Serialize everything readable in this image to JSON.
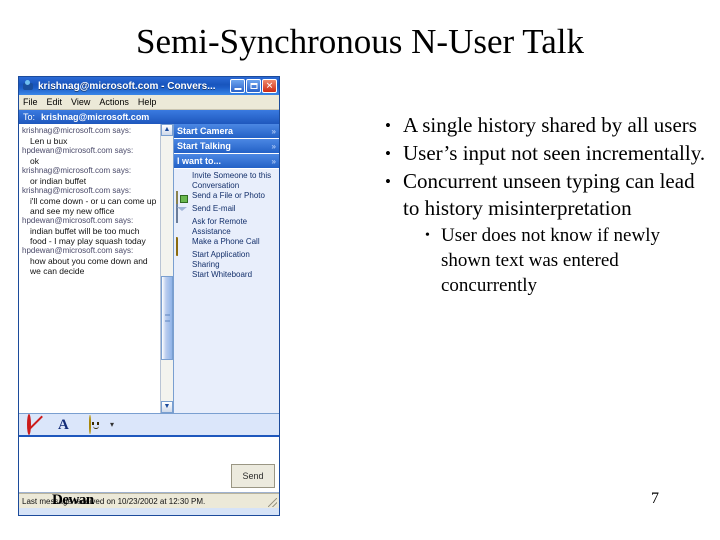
{
  "slide": {
    "title": "Semi-Synchronous  N-User Talk",
    "page_number": "7",
    "footer_author": "Dewan"
  },
  "bullets": [
    {
      "level": 1,
      "marker": "•",
      "text": "A single history shared by all users"
    },
    {
      "level": 1,
      "marker": "•",
      "text": "User’s input not seen incrementally."
    },
    {
      "level": 1,
      "marker": "•",
      "text": "Concurrent unseen typing can lead to history misinterpretation"
    },
    {
      "level": 2,
      "marker": "•",
      "text": "User does not know if newly shown text was entered concurrently"
    }
  ],
  "messenger": {
    "titlebar": {
      "title": "krishnag@microsoft.com - Convers...",
      "minimize_label": "Minimize",
      "maximize_label": "Maximize",
      "close_label": "Close"
    },
    "menubar": [
      "File",
      "Edit",
      "View",
      "Actions",
      "Help"
    ],
    "to_bar": {
      "label": "To:",
      "value": "krishnag@microsoft.com"
    },
    "history": [
      {
        "from": "krishnag@microsoft.com says:",
        "message": "Len u bux"
      },
      {
        "from": "hpdewan@microsoft.com says:",
        "message": "ok"
      },
      {
        "from": "krishnag@microsoft.com says:",
        "message": "or indian buffet"
      },
      {
        "from": "krishnag@microsoft.com says:",
        "message": "i'll come down - or u can come up and see my new office"
      },
      {
        "from": "hpdewan@microsoft.com says:",
        "message": "indian buffet will be too much food - I may play squash today"
      },
      {
        "from": "hpdewan@microsoft.com says:",
        "message": "how about you come down and we can decide"
      }
    ],
    "panels": [
      {
        "label": "Start Camera",
        "chevron": "»"
      },
      {
        "label": "Start Talking",
        "chevron": "»"
      },
      {
        "label": "I want to...",
        "chevron": "»"
      }
    ],
    "actions": [
      {
        "icon": "bullet-icon",
        "label": "Invite Someone to this Conversation"
      },
      {
        "icon": "file-photo-icon",
        "label": "Send a File or Photo"
      },
      {
        "icon": "email-icon",
        "label": "Send E-mail"
      },
      {
        "icon": "bullet-icon",
        "label": "Ask for Remote Assistance"
      },
      {
        "icon": "phone-icon",
        "label": "Make a Phone Call"
      },
      {
        "icon": "bullet-icon",
        "label": "Start Application Sharing"
      },
      {
        "icon": "bullet-icon",
        "label": "Start Whiteboard"
      }
    ],
    "format_toolbar": [
      {
        "icon": "block-icon",
        "label": "Block"
      },
      {
        "icon": "font-icon",
        "label": "Change Font"
      },
      {
        "icon": "emoticon-icon",
        "label": "Emoticons"
      }
    ],
    "compose": {
      "value": "",
      "placeholder": ""
    },
    "send_button_label": "Send",
    "status_text": "Last message received on 10/23/2002 at 12:30 PM.",
    "scrollbar": {
      "up_arrow": "▲",
      "down_arrow": "▼"
    }
  },
  "colors": {
    "title_bar_blue": "#1855bd",
    "panel_header_blue": "#2361c6",
    "window_border": "#1c4b9b",
    "menubar_tan": "#ece9d8",
    "action_text": "#14306b"
  }
}
